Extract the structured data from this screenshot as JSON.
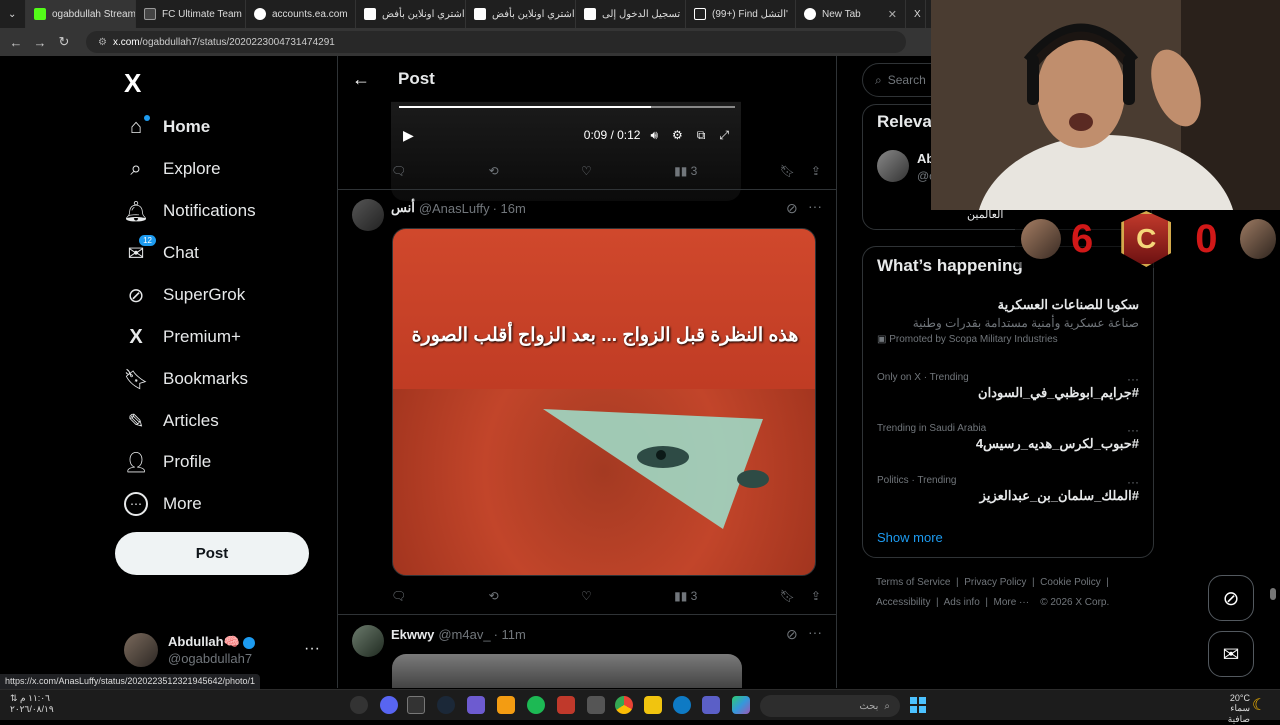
{
  "browser": {
    "tabs": [
      {
        "title": "ogabdullah Stream",
        "color": "#53fc18"
      },
      {
        "title": "FC Ultimate Team",
        "color": "#ffffff"
      },
      {
        "title": "accounts.ea.com",
        "color": "#ffffff"
      },
      {
        "title": "اشتري اونلاين بأفض",
        "color": "#ffffff"
      },
      {
        "title": "اشتري اونلاين بأفض",
        "color": "#ffffff"
      },
      {
        "title": "تسجيل الدخول إلى",
        "color": "#ffffff"
      },
      {
        "title": "(99+) Find التشل'",
        "color": "#ffffff"
      },
      {
        "title": "New Tab",
        "color": "#ffffff"
      }
    ],
    "url_domain": "x.com",
    "url_path": "/ogabdullah7/status/2020223004731474291",
    "status_url": "https://x.com/AnasLuffy/status/2020223512321945642/photo/1"
  },
  "sidebar": {
    "logo": "X",
    "items": [
      {
        "label": "Home",
        "icon": "home-icon",
        "glyph": "⌂"
      },
      {
        "label": "Explore",
        "icon": "search-icon",
        "glyph": "⌕"
      },
      {
        "label": "Notifications",
        "icon": "bell-icon",
        "glyph": "🔔︎"
      },
      {
        "label": "Chat",
        "icon": "mail-icon",
        "glyph": "✉"
      },
      {
        "label": "SuperGrok",
        "icon": "grok-icon",
        "glyph": "⊘"
      },
      {
        "label": "Premium+",
        "icon": "x-logo-icon",
        "glyph": "X"
      },
      {
        "label": "Bookmarks",
        "icon": "bookmark-icon",
        "glyph": "🔖︎"
      },
      {
        "label": "Articles",
        "icon": "article-icon",
        "glyph": "✎"
      },
      {
        "label": "Profile",
        "icon": "person-icon",
        "glyph": "👤︎"
      },
      {
        "label": "More",
        "icon": "more-circle-icon",
        "glyph": "⋯"
      }
    ],
    "chat_badge": "12",
    "post_button": "Post",
    "account": {
      "name": "Abdullah🧠",
      "handle": "@ogabdullah7",
      "more": "···"
    }
  },
  "main": {
    "title": "Post",
    "video": {
      "time": "0:09 / 0:12",
      "progress": 0.75
    },
    "tweet1_views": "3",
    "tweet2": {
      "name": "أنس",
      "handle": "@AnasLuffy",
      "time": "· 16m",
      "image_caption": "هذه النظرة قبل الزواج ... بعد الزواج أقلب الصورة",
      "views": "3"
    },
    "tweet3": {
      "name": "Ekwwy",
      "handle": "@m4av_",
      "time": "· 11m"
    }
  },
  "right": {
    "search_placeholder": "Search",
    "relevant_title": "Relevant people",
    "relevant_person": {
      "name": "Ab",
      "handle": "@c",
      "bio": "العالمين"
    },
    "happening_title": "What’s happening",
    "trends": [
      {
        "context": "",
        "title": "سكوبا للصناعات العسكرية",
        "desc": "صناعة عسكرية وأمنية مستدامة بقدرات وطنية",
        "promo": "Promoted by Scopa Military Industries"
      },
      {
        "context": "Only on X · Trending",
        "title": "#جرايم_ابوظبي_في_السودان"
      },
      {
        "context": "Trending in Saudi Arabia",
        "title": "#حبوب_لكرس_هديه_رسيس4"
      },
      {
        "context": "Politics · Trending",
        "title": "#الملك_سلمان_بن_عبدالعزيز"
      }
    ],
    "show_more": "Show more",
    "footer_links": [
      "Terms of Service",
      "Privacy Policy",
      "Cookie Policy",
      "Accessibility",
      "Ads info",
      "More ···",
      "© 2026 X Corp."
    ]
  },
  "overlay": {
    "score_left": "6",
    "score_right": "0",
    "emblem": "C"
  },
  "taskbar": {
    "time": "١١:٠٦ م",
    "date": "٢٠٢٦/٠٨/١٩",
    "search_placeholder": "بحث",
    "weather_temp": "20°C",
    "weather_desc": "سماء صافية"
  }
}
